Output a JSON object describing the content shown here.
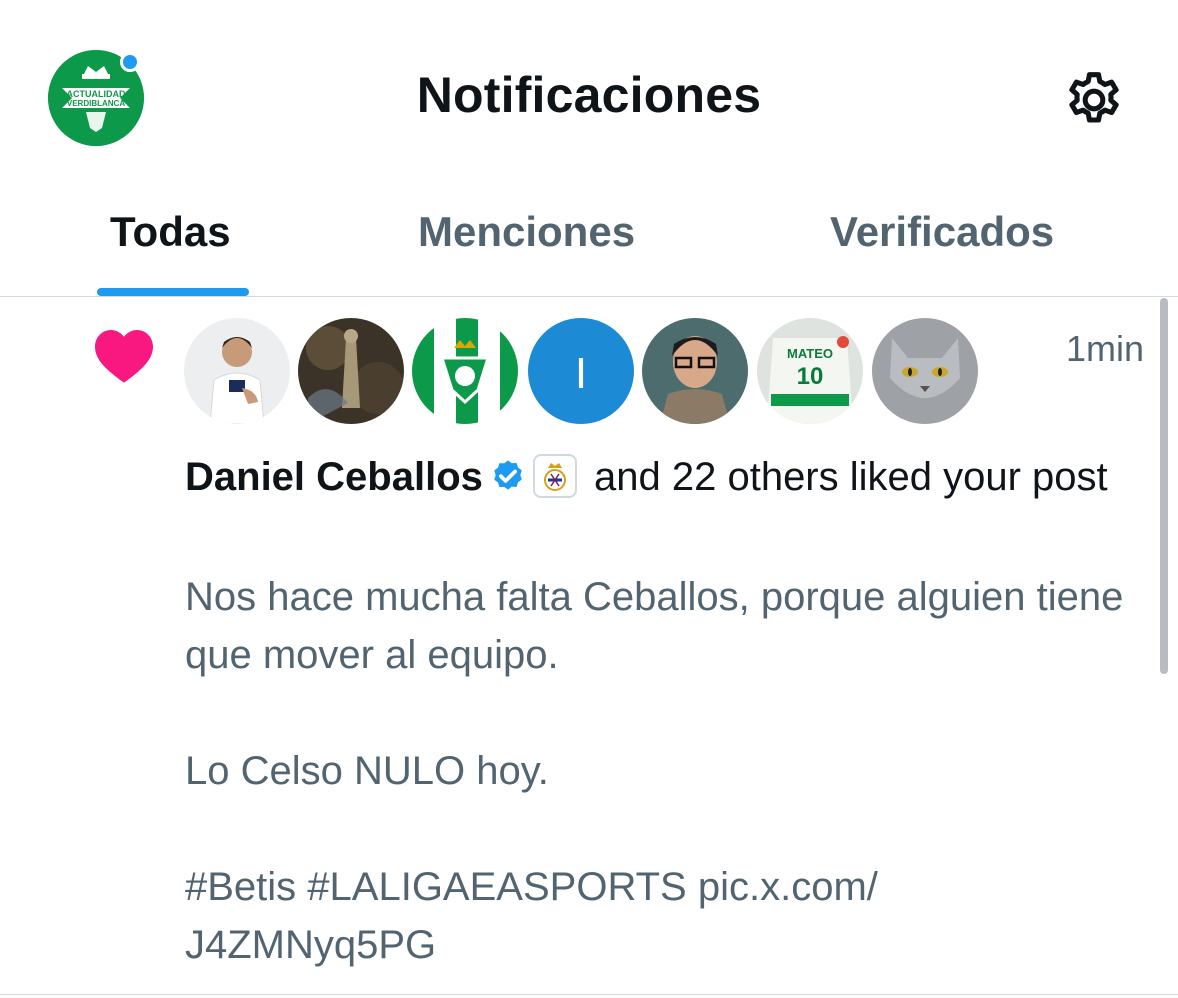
{
  "header": {
    "title": "Notificaciones",
    "settings_icon": "gear-icon",
    "profile_logo_text_top": "ACTUALIDAD",
    "profile_logo_text_bottom": "VERDIBLANCA"
  },
  "tabs": [
    {
      "label": "Todas",
      "active": true
    },
    {
      "label": "Menciones",
      "active": false
    },
    {
      "label": "Verificados",
      "active": false
    }
  ],
  "notification": {
    "type_icon": "heart-icon",
    "time": "1min",
    "avatars": [
      {
        "name": "avatar-player"
      },
      {
        "name": "avatar-statue"
      },
      {
        "name": "avatar-betis-flag"
      },
      {
        "name": "avatar-letter",
        "letter": "I"
      },
      {
        "name": "avatar-man-glasses"
      },
      {
        "name": "avatar-jersey-mateo"
      },
      {
        "name": "avatar-cat"
      }
    ],
    "jersey_name": "MATEO",
    "jersey_number": "10",
    "actor_name": "Daniel Ceballos",
    "action_text": "and 22 others liked your post",
    "post_text": "Nos hace mucha falta Ceballos, porque alguien tiene que mover al equipo.\n\nLo Celso NULO hoy.\n\n#Betis #LALIGAEASPORTS pic.x.com/\nJ4ZMNyq5PG"
  },
  "colors": {
    "accent": "#1d9bf0",
    "heart": "#f91880",
    "betis_green": "#0c9a4a",
    "secondary_text": "#536471"
  }
}
